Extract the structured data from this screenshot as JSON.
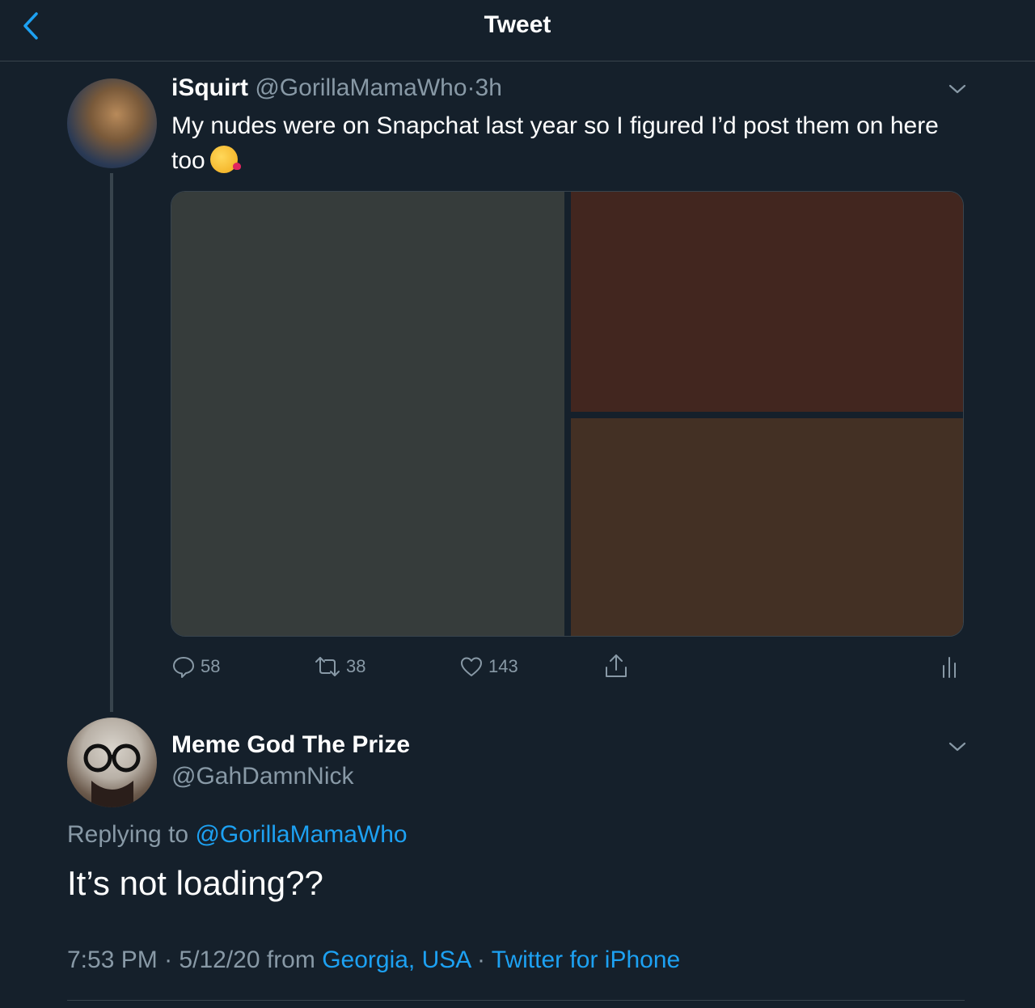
{
  "header": {
    "title": "Tweet",
    "back_icon": "chevron-left-icon",
    "accent_color": "#1da1f2"
  },
  "tweet": {
    "display_name": "iSquirt",
    "handle": "@GorillaMamaWho",
    "separator": "·",
    "time_ago": "3h",
    "text": "My nudes were on Snapchat last year so I figured I’d post them on here too",
    "emoji": "face-blowing-a-kiss-emoji",
    "media_count": 3,
    "actions": {
      "reply_count": "58",
      "retweet_count": "38",
      "like_count": "143"
    }
  },
  "reply": {
    "display_name": "Meme God The Prize",
    "handle": "@GahDamnNick",
    "replying_prefix": "Replying to",
    "replying_to": "@GorillaMamaWho",
    "text": "It’s not loading??",
    "time": "7:53 PM",
    "dot1": "·",
    "date": "5/12/20",
    "from_label": "from",
    "location": "Georgia, USA",
    "dot2": "·",
    "client": "Twitter for iPhone"
  }
}
